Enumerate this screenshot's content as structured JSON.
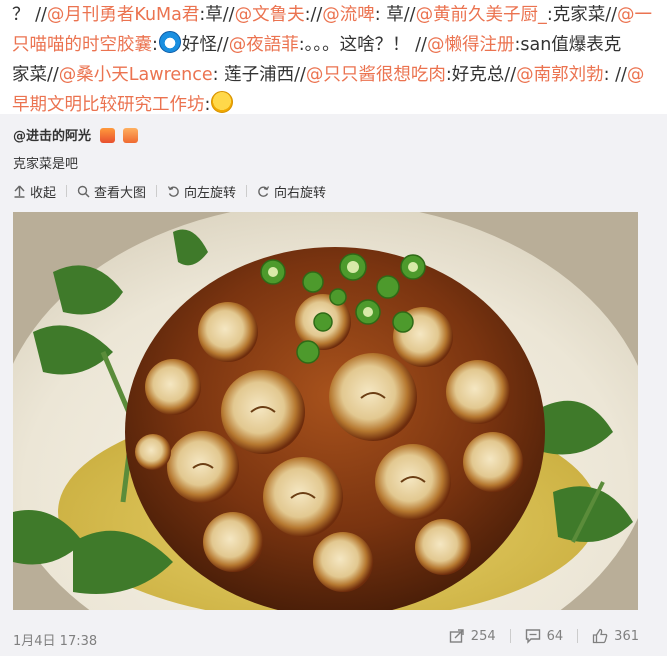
{
  "post": {
    "lines": [
      [
        {
          "t": "text",
          "v": "？ //"
        },
        {
          "t": "mention",
          "v": "@月刊勇者KuMa君"
        },
        {
          "t": "text",
          "v": ":草//"
        },
        {
          "t": "mention",
          "v": "@文鲁夫"
        },
        {
          "t": "text",
          "v": "://"
        },
        {
          "t": "mention",
          "v": "@流啤"
        },
        {
          "t": "text",
          "v": ": 草//"
        },
        {
          "t": "mention",
          "v": "@黄前久美子厨_"
        },
        {
          "t": "text",
          "v": ":克家菜//"
        },
        {
          "t": "mention",
          "v": "@一"
        }
      ],
      [
        {
          "t": "mention",
          "v": "只喵喵的时空胶囊"
        },
        {
          "t": "text",
          "v": ":"
        },
        {
          "t": "emoji",
          "v": "doraemon"
        },
        {
          "t": "text",
          "v": "好怪//"
        },
        {
          "t": "mention",
          "v": "@夜語菲"
        },
        {
          "t": "text",
          "v": ":。。。这啥？！ //"
        },
        {
          "t": "mention",
          "v": "@懒得注册"
        },
        {
          "t": "text",
          "v": ":san值爆表克"
        }
      ],
      [
        {
          "t": "text",
          "v": "家菜//"
        },
        {
          "t": "mention",
          "v": "@桑小天Lawrence"
        },
        {
          "t": "text",
          "v": ": 莲子浦西//"
        },
        {
          "t": "mention",
          "v": "@只只酱很想吃肉"
        },
        {
          "t": "text",
          "v": ":好克总//"
        },
        {
          "t": "mention",
          "v": "@南郭刘勃"
        },
        {
          "t": "text",
          "v": ": //"
        },
        {
          "t": "mention",
          "v": "@"
        }
      ],
      [
        {
          "t": "mention",
          "v": "早期文明比较研究工作坊"
        },
        {
          "t": "text",
          "v": ":"
        },
        {
          "t": "emoji",
          "v": "laugh"
        }
      ]
    ]
  },
  "repost": {
    "author": "@进击的阿光",
    "text": "克家菜是吧",
    "actions": {
      "collapse": "收起",
      "view_large": "查看大图",
      "rotate_left": "向左旋转",
      "rotate_right": "向右旋转"
    }
  },
  "footer": {
    "time": "1月4日 17:38",
    "reposts": "254",
    "comments": "64",
    "likes": "361"
  },
  "colors": {
    "link": "#eb7350",
    "repost_bg": "#f2f2f5",
    "muted": "#808080"
  }
}
